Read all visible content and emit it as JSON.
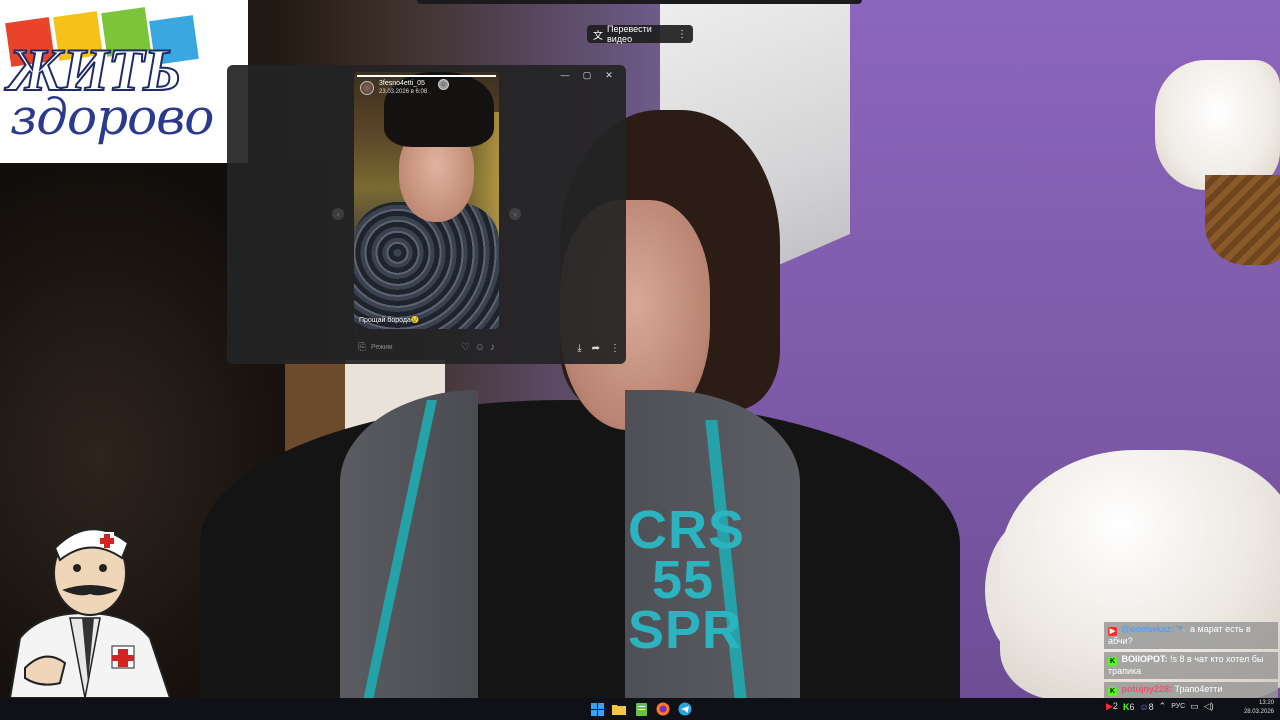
{
  "logo": {
    "line1": "ЖИТЬ",
    "line2": "здорово"
  },
  "translate_button": {
    "label": "Перевести видео"
  },
  "viewer": {
    "author": {
      "name": "3fesno4etti_05",
      "date": "23.03.2026 в 6:08"
    },
    "caption": "Прощай борода😢",
    "progress": 1.0,
    "reply": {
      "placeholder": "Режим"
    }
  },
  "shirt_print": {
    "line1": "CRS",
    "line2": "55",
    "line3": "SPR"
  },
  "chat": [
    {
      "platform": "youtube",
      "color": "#ff2b2b",
      "user": "@oomwkaz:",
      "user_color": "#4aa3ff",
      "text": "🔧 а марат есть в абчи?"
    },
    {
      "platform": "kick",
      "color": "#53fc18",
      "user": "BOIIOPOT:",
      "user_color": "#ffffff",
      "text": "!s 8 в чат кто хотел бы трапика"
    },
    {
      "platform": "kick",
      "color": "#53fc18",
      "user": "potujny228:",
      "user_color": "#ff4a6a",
      "text": "Трапо4етти"
    }
  ],
  "tray": {
    "yt_count": "2",
    "kick_count": "6",
    "viewers": "8",
    "lang": "РУС"
  },
  "clock": {
    "time": "13:20",
    "date": "28.03.2026"
  }
}
